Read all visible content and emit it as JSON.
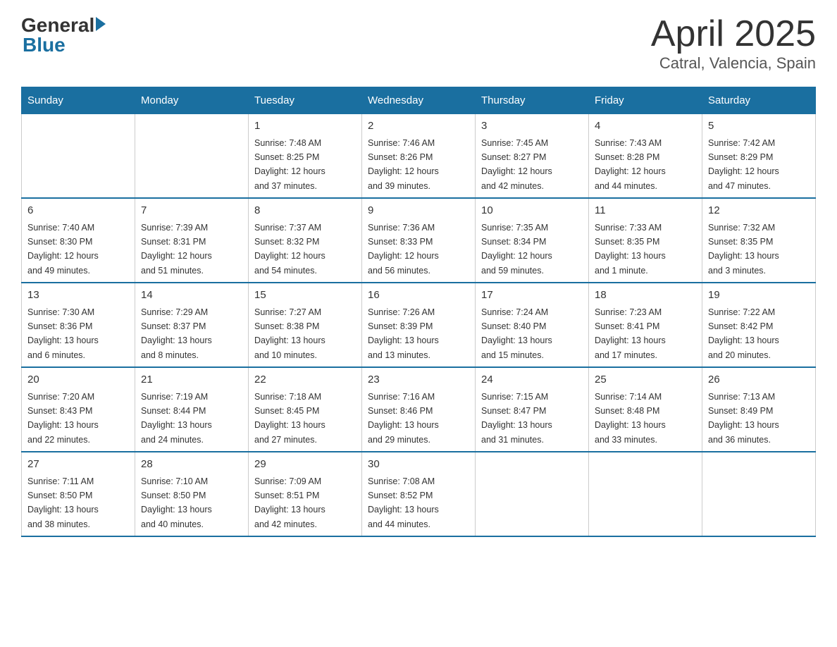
{
  "logo": {
    "text_general": "General",
    "text_blue": "Blue"
  },
  "title": "April 2025",
  "subtitle": "Catral, Valencia, Spain",
  "days_of_week": [
    "Sunday",
    "Monday",
    "Tuesday",
    "Wednesday",
    "Thursday",
    "Friday",
    "Saturday"
  ],
  "weeks": [
    [
      {
        "day": "",
        "info": ""
      },
      {
        "day": "",
        "info": ""
      },
      {
        "day": "1",
        "info": "Sunrise: 7:48 AM\nSunset: 8:25 PM\nDaylight: 12 hours\nand 37 minutes."
      },
      {
        "day": "2",
        "info": "Sunrise: 7:46 AM\nSunset: 8:26 PM\nDaylight: 12 hours\nand 39 minutes."
      },
      {
        "day": "3",
        "info": "Sunrise: 7:45 AM\nSunset: 8:27 PM\nDaylight: 12 hours\nand 42 minutes."
      },
      {
        "day": "4",
        "info": "Sunrise: 7:43 AM\nSunset: 8:28 PM\nDaylight: 12 hours\nand 44 minutes."
      },
      {
        "day": "5",
        "info": "Sunrise: 7:42 AM\nSunset: 8:29 PM\nDaylight: 12 hours\nand 47 minutes."
      }
    ],
    [
      {
        "day": "6",
        "info": "Sunrise: 7:40 AM\nSunset: 8:30 PM\nDaylight: 12 hours\nand 49 minutes."
      },
      {
        "day": "7",
        "info": "Sunrise: 7:39 AM\nSunset: 8:31 PM\nDaylight: 12 hours\nand 51 minutes."
      },
      {
        "day": "8",
        "info": "Sunrise: 7:37 AM\nSunset: 8:32 PM\nDaylight: 12 hours\nand 54 minutes."
      },
      {
        "day": "9",
        "info": "Sunrise: 7:36 AM\nSunset: 8:33 PM\nDaylight: 12 hours\nand 56 minutes."
      },
      {
        "day": "10",
        "info": "Sunrise: 7:35 AM\nSunset: 8:34 PM\nDaylight: 12 hours\nand 59 minutes."
      },
      {
        "day": "11",
        "info": "Sunrise: 7:33 AM\nSunset: 8:35 PM\nDaylight: 13 hours\nand 1 minute."
      },
      {
        "day": "12",
        "info": "Sunrise: 7:32 AM\nSunset: 8:35 PM\nDaylight: 13 hours\nand 3 minutes."
      }
    ],
    [
      {
        "day": "13",
        "info": "Sunrise: 7:30 AM\nSunset: 8:36 PM\nDaylight: 13 hours\nand 6 minutes."
      },
      {
        "day": "14",
        "info": "Sunrise: 7:29 AM\nSunset: 8:37 PM\nDaylight: 13 hours\nand 8 minutes."
      },
      {
        "day": "15",
        "info": "Sunrise: 7:27 AM\nSunset: 8:38 PM\nDaylight: 13 hours\nand 10 minutes."
      },
      {
        "day": "16",
        "info": "Sunrise: 7:26 AM\nSunset: 8:39 PM\nDaylight: 13 hours\nand 13 minutes."
      },
      {
        "day": "17",
        "info": "Sunrise: 7:24 AM\nSunset: 8:40 PM\nDaylight: 13 hours\nand 15 minutes."
      },
      {
        "day": "18",
        "info": "Sunrise: 7:23 AM\nSunset: 8:41 PM\nDaylight: 13 hours\nand 17 minutes."
      },
      {
        "day": "19",
        "info": "Sunrise: 7:22 AM\nSunset: 8:42 PM\nDaylight: 13 hours\nand 20 minutes."
      }
    ],
    [
      {
        "day": "20",
        "info": "Sunrise: 7:20 AM\nSunset: 8:43 PM\nDaylight: 13 hours\nand 22 minutes."
      },
      {
        "day": "21",
        "info": "Sunrise: 7:19 AM\nSunset: 8:44 PM\nDaylight: 13 hours\nand 24 minutes."
      },
      {
        "day": "22",
        "info": "Sunrise: 7:18 AM\nSunset: 8:45 PM\nDaylight: 13 hours\nand 27 minutes."
      },
      {
        "day": "23",
        "info": "Sunrise: 7:16 AM\nSunset: 8:46 PM\nDaylight: 13 hours\nand 29 minutes."
      },
      {
        "day": "24",
        "info": "Sunrise: 7:15 AM\nSunset: 8:47 PM\nDaylight: 13 hours\nand 31 minutes."
      },
      {
        "day": "25",
        "info": "Sunrise: 7:14 AM\nSunset: 8:48 PM\nDaylight: 13 hours\nand 33 minutes."
      },
      {
        "day": "26",
        "info": "Sunrise: 7:13 AM\nSunset: 8:49 PM\nDaylight: 13 hours\nand 36 minutes."
      }
    ],
    [
      {
        "day": "27",
        "info": "Sunrise: 7:11 AM\nSunset: 8:50 PM\nDaylight: 13 hours\nand 38 minutes."
      },
      {
        "day": "28",
        "info": "Sunrise: 7:10 AM\nSunset: 8:50 PM\nDaylight: 13 hours\nand 40 minutes."
      },
      {
        "day": "29",
        "info": "Sunrise: 7:09 AM\nSunset: 8:51 PM\nDaylight: 13 hours\nand 42 minutes."
      },
      {
        "day": "30",
        "info": "Sunrise: 7:08 AM\nSunset: 8:52 PM\nDaylight: 13 hours\nand 44 minutes."
      },
      {
        "day": "",
        "info": ""
      },
      {
        "day": "",
        "info": ""
      },
      {
        "day": "",
        "info": ""
      }
    ]
  ]
}
